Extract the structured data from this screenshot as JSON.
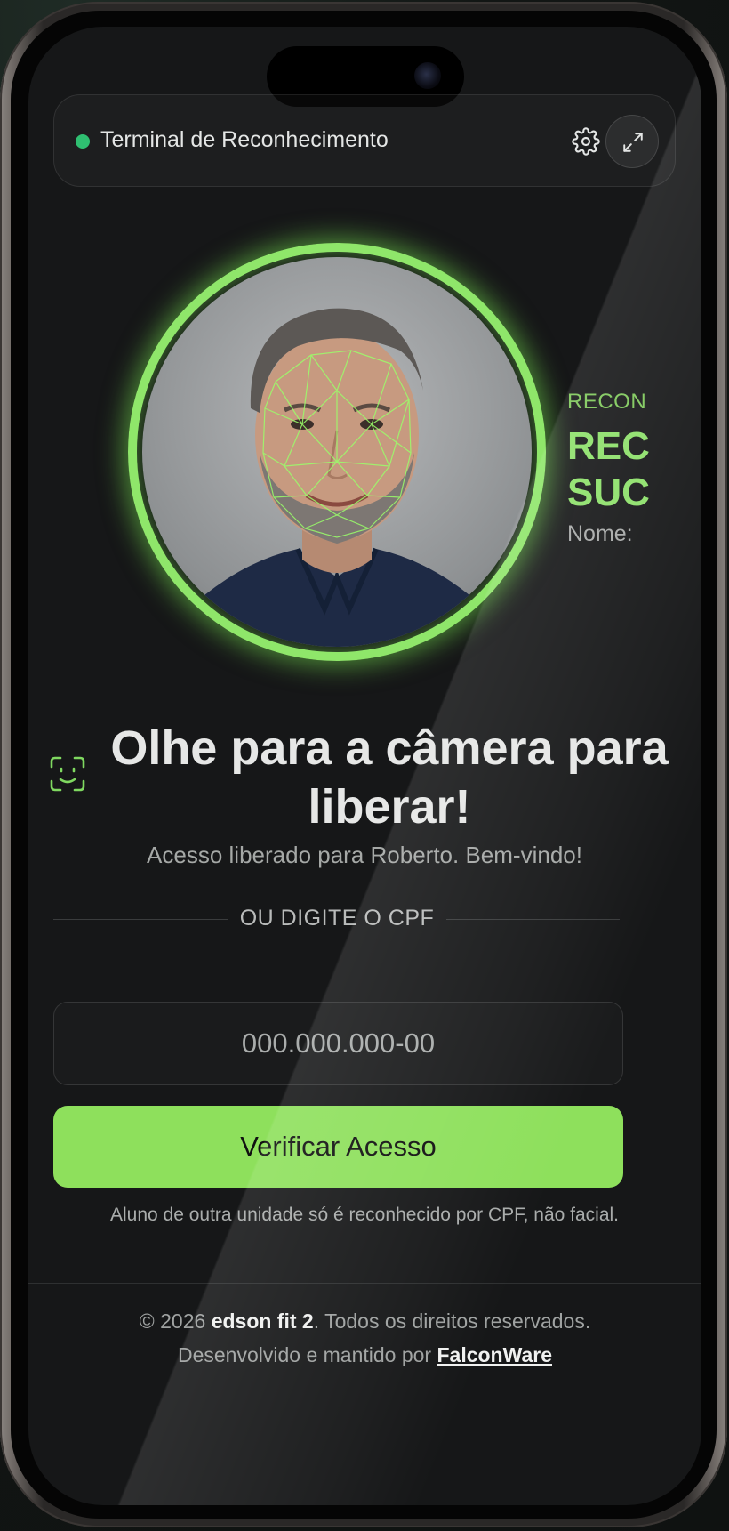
{
  "header": {
    "title": "Terminal de Reconhecimento",
    "status_color": "#2fbf71",
    "settings_icon": "gear-icon",
    "fullscreen_icon": "expand-icon"
  },
  "camera": {
    "ring_color": "#8fe66a",
    "overlay": "face-mesh"
  },
  "result": {
    "kicker": "RECON",
    "title_line1": "REC",
    "title_line2": "SUC",
    "name_label": "Nome:"
  },
  "main": {
    "face_icon": "face-id-icon",
    "title": "Olhe para a câmera para liberar!",
    "subtitle": "Acesso liberado para Roberto. Bem-vindo!"
  },
  "divider": {
    "label": "OU DIGITE O CPF"
  },
  "cpf": {
    "placeholder": "000.000.000-00",
    "value": ""
  },
  "verify_button": {
    "label": "Verificar Acesso",
    "color": "#8ee05c"
  },
  "note": "Aluno de outra unidade só é reconhecido por CPF, não facial.",
  "footer": {
    "copyright_prefix": "© 2026 ",
    "brand": "edson fit 2",
    "copyright_suffix": ". Todos os direitos reservados.",
    "dev_prefix": "Desenvolvido e mantido por ",
    "dev_link": "FalconWare"
  }
}
